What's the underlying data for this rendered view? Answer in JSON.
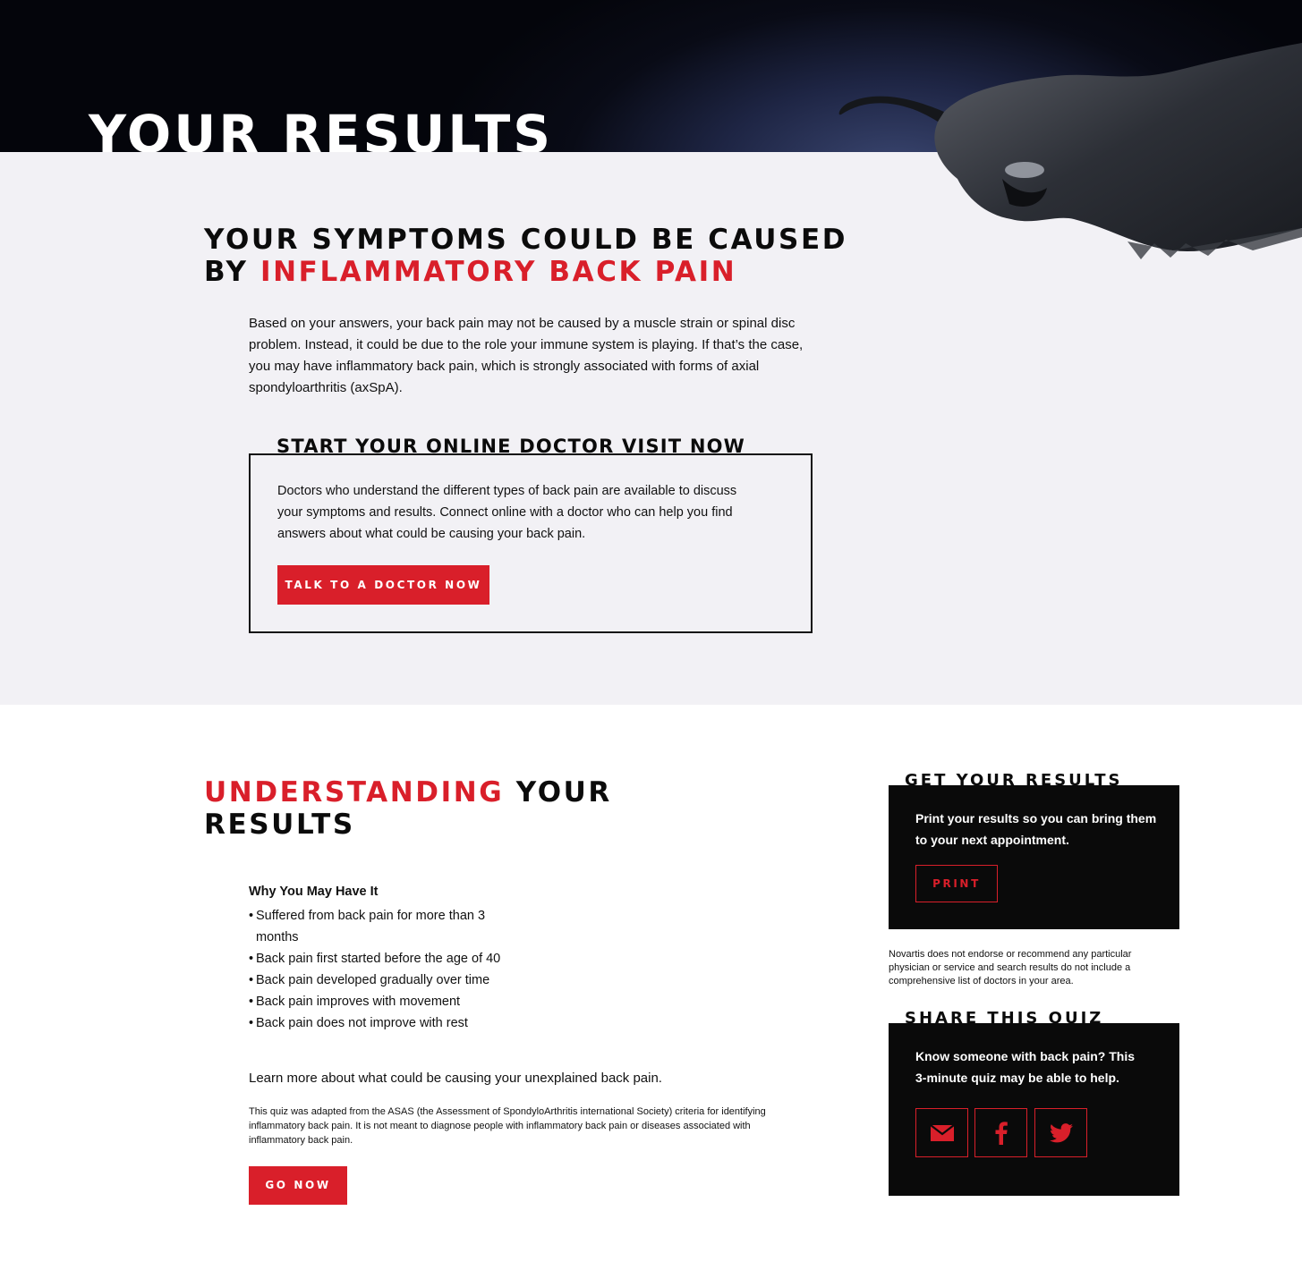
{
  "hero": {
    "title": "YOUR RESULTS"
  },
  "main": {
    "heading_line1": "YOUR SYMPTOMS COULD BE CAUSED",
    "heading_prefix": "BY ",
    "heading_highlight": "INFLAMMATORY BACK PAIN",
    "intro": "Based on your answers, your back pain may not be caused by a muscle strain or spinal disc problem. Instead, it could be due to the role your immune system is playing. If that’s the case, you may have inflammatory back pain, which is strongly associated with forms of axial spondyloarthritis (axSpA)."
  },
  "doctor_visit": {
    "title": "START YOUR ONLINE DOCTOR VISIT NOW",
    "text": "Doctors who understand the different types of back pain are available to discuss your symptoms and results. Connect online with a doctor who can help you find answers about what could be causing your back pain.",
    "button": "TALK TO A DOCTOR NOW"
  },
  "understanding": {
    "heading_highlight": "UNDERSTANDING",
    "heading_rest1": " YOUR",
    "heading_rest2": "RESULTS",
    "why_title": "Why You May Have It",
    "bullets": [
      "Suffered from back pain for more than 3 months",
      "Back pain first started before the age of 40",
      "Back pain developed gradually over time",
      "Back pain improves with movement",
      "Back pain does not improve with rest"
    ],
    "learn_more": "Learn more about what could be causing your unexplained back pain.",
    "quiz_disclaimer": "This quiz was adapted from the ASAS (the Assessment of SpondyloArthritis international Society) criteria for identifying inflammatory back pain. It is not meant to diagnose people with inflammatory back pain or diseases associated with inflammatory back pain.",
    "go_button": "GO NOW"
  },
  "get_results": {
    "title": "GET YOUR RESULTS",
    "text": "Print your results so you can bring them to your next appointment.",
    "button": "PRINT"
  },
  "novartis_disclaimer": "Novartis does not endorse or recommend any particular physician or service and search results do not include a comprehensive list of doctors in your area.",
  "share": {
    "title": "SHARE THIS QUIZ",
    "text": "Know someone with back pain? This 3-minute quiz may be able to help.",
    "icons": [
      "email-icon",
      "facebook-icon",
      "twitter-icon"
    ]
  },
  "colors": {
    "accent": "#d91f2a",
    "panel": "#0a0a0a",
    "grey_bg": "#f2f1f5"
  }
}
